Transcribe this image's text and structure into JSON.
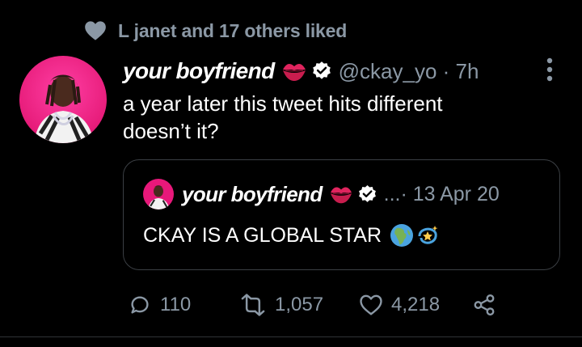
{
  "social_context": {
    "text": "L janet and 17 others liked",
    "icon": "heart-icon"
  },
  "tweet": {
    "author_name": "your boyfriend",
    "handle": "@ckay_yo · 7h",
    "text_line1": "a year later this tweet hits different",
    "text_line2": "doesn’t it?",
    "author_emoji": "kiss-mark-icon",
    "verified_icon": "verified-badge-icon"
  },
  "quote": {
    "author_name": "your boyfriend",
    "meta": "...· 13 Apr 20",
    "text": "CKAY IS A GLOBAL STAR",
    "emojis": [
      "globe-africa-icon",
      "dizzy-icon"
    ]
  },
  "actions": {
    "replies": "110",
    "retweets": "1,057",
    "likes": "4,218"
  },
  "colors": {
    "background": "#000000",
    "text": "#ffffff",
    "muted": "#8b98a5",
    "border": "#3b3f44",
    "lips": "#e0245e"
  }
}
